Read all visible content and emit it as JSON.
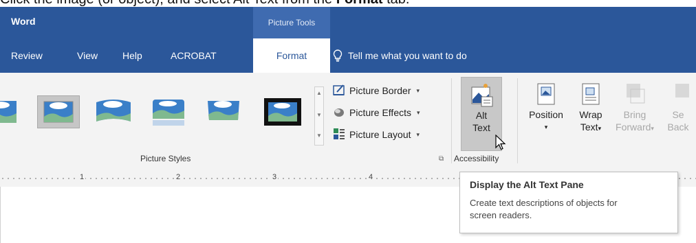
{
  "instruction": {
    "prefix": "Click the image (or object), and select Alt Text from the ",
    "bold": "Format",
    "suffix": " tab."
  },
  "titlebar": {
    "app_name": "Word",
    "contextual_tab_group": "Picture Tools"
  },
  "tabs": [
    {
      "label": "Review",
      "active": false
    },
    {
      "label": "View",
      "active": false
    },
    {
      "label": "Help",
      "active": false
    },
    {
      "label": "ACROBAT",
      "active": false
    },
    {
      "label": "Format",
      "active": true
    }
  ],
  "tell_me": {
    "label": "Tell me what you want to do",
    "icon": "lightbulb-icon"
  },
  "picture_styles": {
    "group_label": "Picture Styles",
    "commands": [
      {
        "label": "Picture Border",
        "icon": "picture-border-icon"
      },
      {
        "label": "Picture Effects",
        "icon": "picture-effects-icon"
      },
      {
        "label": "Picture Layout",
        "icon": "picture-layout-icon"
      }
    ]
  },
  "accessibility": {
    "group_label": "Accessibility",
    "alt_text": {
      "line1": "Alt",
      "line2": "Text"
    }
  },
  "arrange": {
    "position": {
      "line1": "Position"
    },
    "wrap_text": {
      "line1": "Wrap",
      "line2": "Text"
    },
    "bring_forward": {
      "line1": "Bring",
      "line2": "Forward"
    },
    "send_backward": {
      "line1": "Se",
      "line2": "Back"
    }
  },
  "ruler": {
    "numbers": [
      "1",
      "2",
      "3",
      "4"
    ]
  },
  "tooltip": {
    "title": "Display the Alt Text Pane",
    "body": "Create text descriptions of objects for screen readers."
  },
  "colors": {
    "word_blue": "#2b579a",
    "ribbon_bg": "#f3f3f3"
  }
}
